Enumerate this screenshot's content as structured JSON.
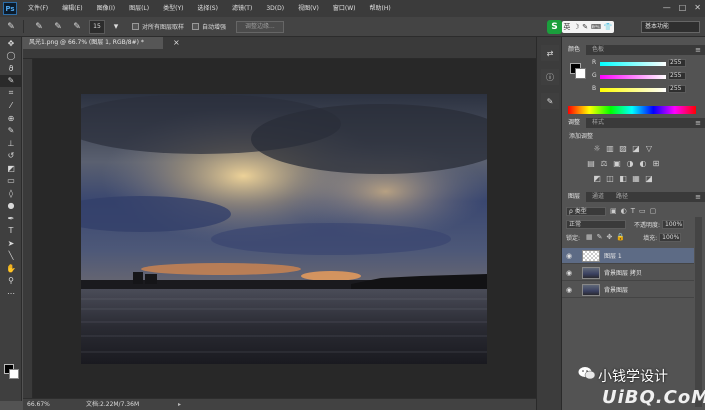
{
  "app": {
    "logo": "Ps"
  },
  "menu": [
    "文件(F)",
    "编辑(E)",
    "图像(I)",
    "图层(L)",
    "类型(Y)",
    "选择(S)",
    "滤镜(T)",
    "3D(D)",
    "视图(V)",
    "窗口(W)",
    "帮助(H)"
  ],
  "window_controls": {
    "minimize": "—",
    "maximize": "□",
    "close": "✕"
  },
  "options": {
    "brush_size": "15",
    "sample_all_layers_label": "对所有图层取样",
    "auto_enhance_label": "自动增强",
    "refine_edge_label": "调整边缘...",
    "workspace": "基本功能",
    "ime_badge": "S",
    "ime_items": [
      "英",
      "☽",
      "✎",
      "⌨",
      "👕"
    ]
  },
  "document": {
    "tab_title": "风光1.png @ 66.7% (图层 1, RGB/8#) *",
    "tab_close": "×",
    "zoom": "66.67%",
    "doc_size": "文档:2.22M/7.36M"
  },
  "colors": {
    "panel_tabs": [
      "颜色",
      "色板"
    ],
    "channels": [
      {
        "label": "R",
        "value": "255",
        "gradient": "linear-gradient(to right, #00ffff, #ffffff)"
      },
      {
        "label": "G",
        "value": "255",
        "gradient": "linear-gradient(to right, #ff00ff, #ffffff)"
      },
      {
        "label": "B",
        "value": "255",
        "gradient": "linear-gradient(to right, #ffff00, #ffffff)"
      }
    ]
  },
  "adjustments": {
    "panel_tabs": [
      "调整",
      "样式"
    ],
    "add_label": "添加调整",
    "row1": [
      "☼",
      "▥",
      "▨",
      "◪",
      "▽"
    ],
    "row2": [
      "▤",
      "⚖",
      "▣",
      "◑",
      "◐",
      "⊞"
    ],
    "row3": [
      "◩",
      "◫",
      "◧",
      "▦",
      "◪"
    ]
  },
  "layers": {
    "panel_tabs": [
      "图层",
      "通道",
      "路径"
    ],
    "filter_label": "ρ 类型",
    "blend_mode": "正常",
    "opacity_label": "不透明度:",
    "opacity": "100%",
    "lock_label": "锁定:",
    "fill_label": "填充:",
    "fill": "100%",
    "items": [
      {
        "name": "图层 1",
        "selected": true
      },
      {
        "name": "背景图层 拷贝",
        "selected": false
      },
      {
        "name": "背景图层",
        "selected": false
      }
    ]
  },
  "watermark": {
    "name": "小钱学设计",
    "site": "UiBQ.CoM"
  }
}
